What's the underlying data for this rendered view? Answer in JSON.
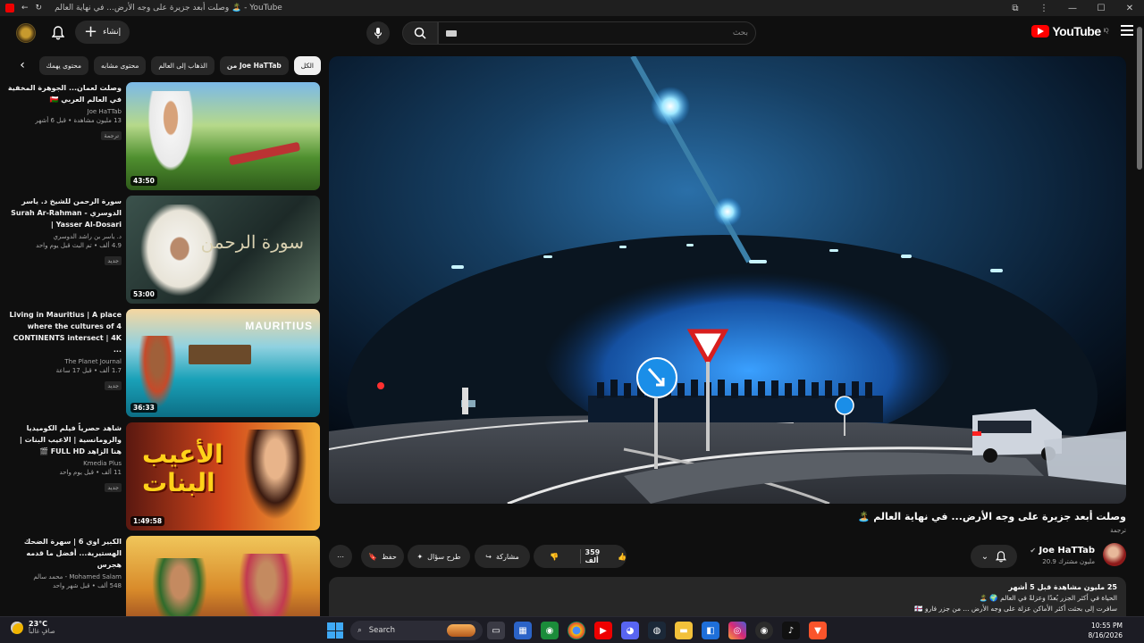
{
  "browser": {
    "title": "وصلت أبعد جزيرة على وجه الأرض... في نهاية العالم 🏝️ - YouTube",
    "controls": [
      "—",
      "☐",
      "✕"
    ]
  },
  "header": {
    "logo_text": "YouTube",
    "country_code": "IQ",
    "search_placeholder": "بحث",
    "create_label": "إنشاء"
  },
  "chips": {
    "items": [
      {
        "label": "الكل",
        "active": true
      },
      {
        "label": "من Joe HaTTab",
        "active": false
      },
      {
        "label": "الذهاب إلى العالم",
        "active": false
      },
      {
        "label": "محتوى مشابه",
        "active": false
      },
      {
        "label": "محتوى يهمك",
        "active": false
      }
    ]
  },
  "recommendations": [
    {
      "title": "وصلت لعمان... الجوهرة المخفية في العالم العربي 🇴🇲",
      "channel": "Joe HaTTab",
      "stats": "13 مليون مشاهدة • قبل 6 أشهر",
      "badge": "ترجمة",
      "duration": "43:50",
      "colors": [
        "#6aa84f",
        "#2f6b2b"
      ]
    },
    {
      "title": "سورة الرحمن للشيخ د. ياسر الدوسري - Surah Ar-Rahman | Yasser Al-Dosari",
      "channel": "د. ياسر بن راشد الدوسري",
      "stats": "4.9 ألف • تم البث قبل يوم واحد",
      "badge": "جديد",
      "duration": "53:00",
      "colors": [
        "#2c3f3c",
        "#556b62"
      ]
    },
    {
      "title": "Living in Mauritius | A place where the cultures of 4 CONTINENTS intersect | 4K ...",
      "channel": "The Planet Journal",
      "stats": "1.7 ألف • قبل 17 ساعة",
      "badge": "جديد",
      "duration": "36:33",
      "colors": [
        "#2aa7c7",
        "#c28a4a"
      ]
    },
    {
      "title": "شاهد حصرياً فيلم الكوميديا والرومانسية | الاعيب البنات | هنا الزاهد FULL HD 🎬",
      "channel": "Kmedia Plus",
      "stats": "11 ألف • قبل يوم واحد",
      "badge": "جديد",
      "duration": "1:49:58",
      "colors": [
        "#f4c200",
        "#d8451b"
      ]
    },
    {
      "title": "الكبير اوي 6 | سهرة الضحك الهستيرية... أفضل ما قدمه هجرس",
      "channel": "Mohamed Salam - محمد سالم",
      "stats": "548 ألف • قبل شهر واحد",
      "badge": "",
      "duration": "",
      "colors": [
        "#e0a23a",
        "#7a2b1c"
      ]
    }
  ],
  "video": {
    "title": "وصلت أبعد جزيرة على وجه الأرض... في نهاية العالم 🏝️",
    "subtitle_badge": "ترجمة",
    "channel_name": "Joe HaTTab",
    "subscribers": "20.9 مليون مشترك",
    "likes": "359 ألف",
    "share_label": "مشاركة",
    "ask_label": "طرح سؤال",
    "save_label": "حفظ"
  },
  "description": {
    "stats": "25 مليون مشاهدة  قبل 5 أشهر",
    "line1": "الحياة في أكثر الجزر بُعدًا وعزلةً في العالم 🌍 🏝️",
    "line2": "سافرت إلى بحثت أكثر الأماكن عزلة على وجه الأرض ... من جزر فارو 🇫🇴"
  },
  "taskbar": {
    "temperature": "23°C",
    "weather_desc": "صافٍ غالباً",
    "search_label": "Search",
    "time": "10:55 PM",
    "date": "8/16/2026"
  }
}
